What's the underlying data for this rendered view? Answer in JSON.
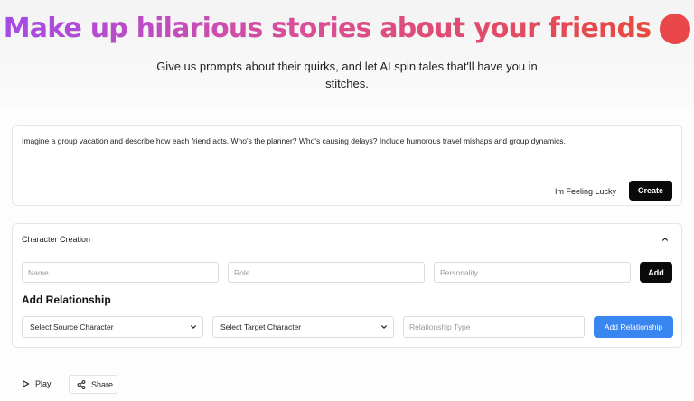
{
  "hero": {
    "title": "Make up hilarious stories about your friends",
    "subtitle_line1": "Give us prompts about their quirks, and let AI spin tales that'll have you in",
    "subtitle_line2": "stitches."
  },
  "prompt": {
    "text": "Imagine a group vacation and describe how each friend acts. Who's the planner? Who's causing delays? Include humorous travel mishaps and group dynamics.",
    "lucky_label": "Im Feeling Lucky",
    "create_label": "Create"
  },
  "character_creation": {
    "header": "Character Creation",
    "name_placeholder": "Name",
    "role_placeholder": "Role",
    "personality_placeholder": "Personality",
    "add_label": "Add"
  },
  "relationship": {
    "title": "Add Relationship",
    "source_select": "Select Source Character",
    "target_select": "Select Target Character",
    "type_placeholder": "Relationship Type",
    "add_label": "Add Relationship"
  },
  "actions": {
    "play_label": "Play",
    "share_label": "Share"
  },
  "colors": {
    "title_gradient_start": "#a34be7",
    "title_gradient_end": "#e8493f",
    "accent_blue": "#3a86f0",
    "button_dark": "#0a0a0a"
  }
}
